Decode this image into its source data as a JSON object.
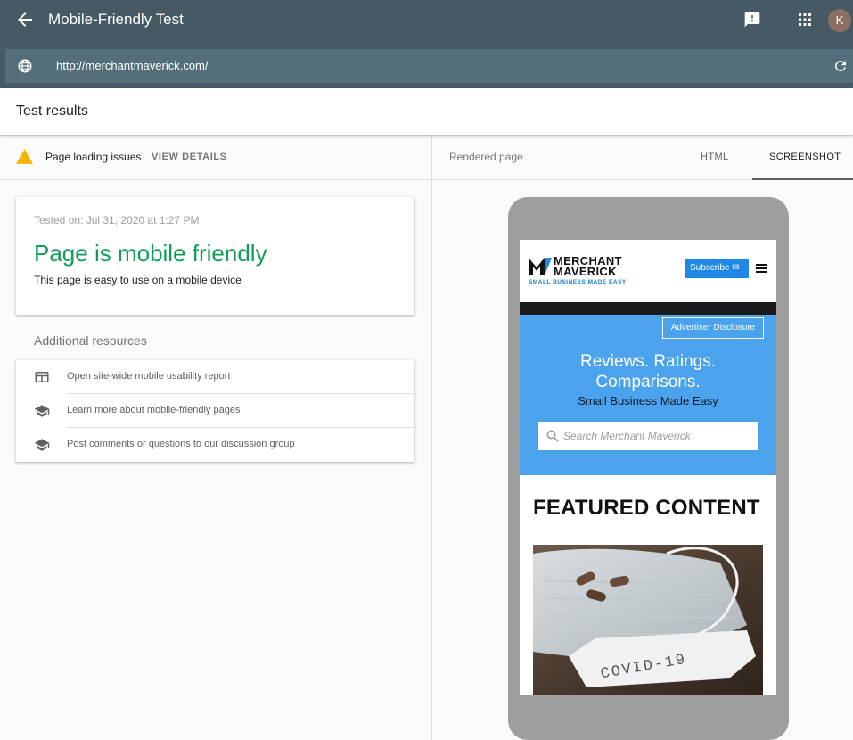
{
  "appbar": {
    "title": "Mobile-Friendly Test",
    "avatar_initial": "K",
    "url": "http://merchantmaverick.com/"
  },
  "results": {
    "heading": "Test results",
    "issues_label": "Page loading issues",
    "view_details": "VIEW DETAILS"
  },
  "summary": {
    "tested_on": "Tested on: Jul 31, 2020 at 1:27 PM",
    "verdict": "Page is mobile friendly",
    "subtitle": "This page is easy to use on a mobile device",
    "verdict_color": "#0f9d58"
  },
  "resources": {
    "heading": "Additional resources",
    "items": [
      {
        "label": "Open site-wide mobile usability report",
        "icon": "report-icon"
      },
      {
        "label": "Learn more about mobile-friendly pages",
        "icon": "school-icon"
      },
      {
        "label": "Post comments or questions to our discussion group",
        "icon": "school-icon"
      }
    ]
  },
  "rendered": {
    "label": "Rendered page",
    "tabs": [
      "HTML",
      "SCREENSHOT"
    ],
    "active_tab": "SCREENSHOT"
  },
  "site": {
    "name_line1": "MERCHANT",
    "name_line2": "MAVERICK",
    "tagline": "SMALL BUSINESS MADE EASY",
    "subscribe": "Subscribe",
    "advertiser_disclosure": "Advertiser Disclosure",
    "hero_line1": "Reviews. Ratings.",
    "hero_line2": "Comparisons.",
    "hero_sub": "Small Business Made Easy",
    "search_placeholder": "Search Merchant Maverick",
    "featured": "FEATURED CONTENT",
    "photo_text": "COVID-19"
  }
}
